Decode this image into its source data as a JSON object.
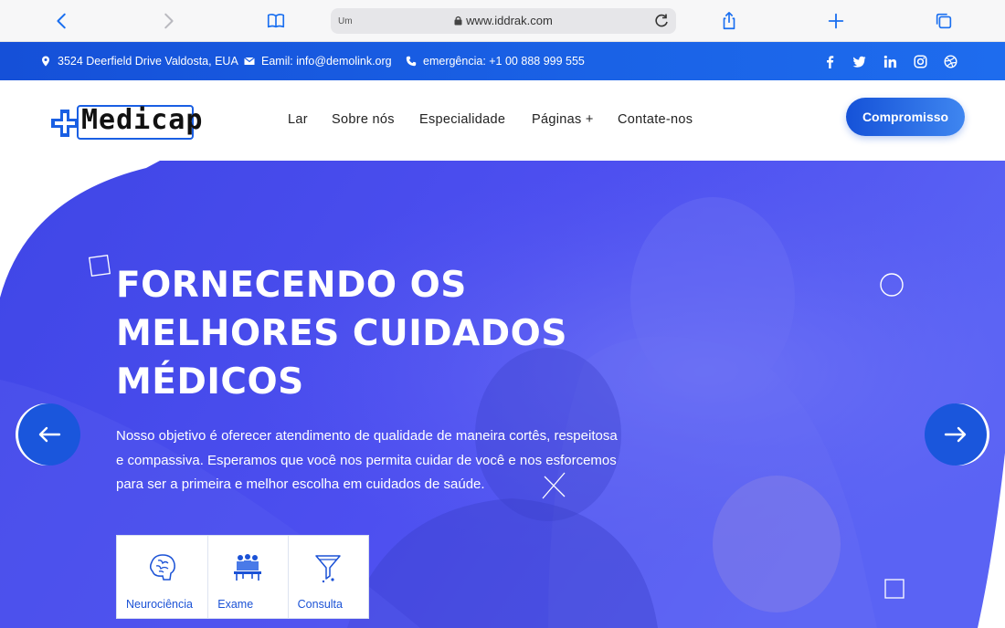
{
  "browser": {
    "address_label": "Um",
    "url": "www.iddrak.com"
  },
  "infobar": {
    "address": "3524 Deerfield Drive Valdosta, EUA",
    "email": "Eamil: info@demolink.org",
    "emergency": "emergência: +1 00 888 999 555",
    "socials": [
      "facebook-icon",
      "twitter-icon",
      "linkedin-icon",
      "instagram-icon",
      "dribbble-icon"
    ]
  },
  "nav": {
    "logo_text": "Medicap",
    "links": [
      "Lar",
      "Sobre nós",
      "Especialidade",
      "Páginas +",
      "Contate-nos"
    ],
    "cta": "Compromisso"
  },
  "hero": {
    "headline": [
      "FORNECENDO OS",
      "MELHORES CUIDADOS",
      "MÉDICOS"
    ],
    "description": [
      "Nosso objetivo é oferecer atendimento de qualidade de maneira cortês, respeitosa",
      "e compassiva. Esperamos que você nos permita cuidar de você e nos esforcemos",
      "para ser a primeira e melhor escolha em cuidados de saúde."
    ],
    "services": [
      {
        "label": "Neurociência",
        "icon": "brain-icon"
      },
      {
        "label": "Exame",
        "icon": "team-icon"
      },
      {
        "label": "Consulta",
        "icon": "funnel-icon"
      }
    ]
  },
  "colors": {
    "primary": "#1a56dc",
    "hero_overlay": "#4a55f0",
    "white": "#ffffff"
  }
}
